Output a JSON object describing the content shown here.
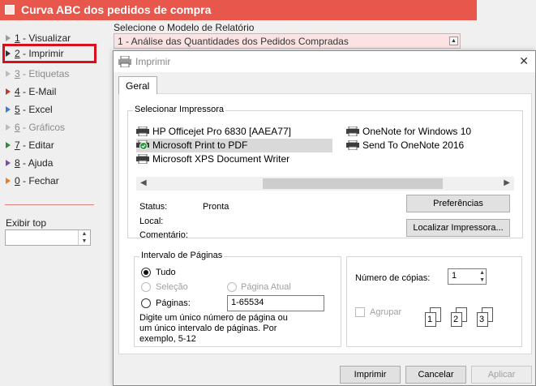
{
  "app": {
    "title": "Curva ABC dos pedidos de compra",
    "menu": [
      {
        "key": "1",
        "label": " - Visualizar",
        "color": "#9a9a9a",
        "disabled": false
      },
      {
        "key": "2",
        "label": " - Imprimir",
        "color": "#333333",
        "disabled": false,
        "selected": true
      },
      {
        "key": "3",
        "label": " - Etiquetas",
        "color": "#9a9a9a",
        "disabled": true
      },
      {
        "key": "4",
        "label": " - E-Mail",
        "color": "#c0392b",
        "disabled": false
      },
      {
        "key": "5",
        "label": " - Excel",
        "color": "#3a7bd5",
        "disabled": false
      },
      {
        "key": "6",
        "label": " - Gráficos",
        "color": "#9a9a9a",
        "disabled": true
      },
      {
        "key": "7",
        "label": " - Editar",
        "color": "#2e8b3a",
        "disabled": false
      },
      {
        "key": "8",
        "label": " - Ajuda",
        "color": "#7a4ea0",
        "disabled": false
      },
      {
        "key": "0",
        "label": " - Fechar",
        "color": "#e67e22",
        "disabled": false
      }
    ],
    "top_label": "Exibir top",
    "top_value": "",
    "model_label": "Selecione o Modelo de Relatório",
    "model_value": "1 - Análise das Quantidades dos Pedidos Compradas"
  },
  "dialog": {
    "title": "Imprimir",
    "tab": "Geral",
    "printer_group": "Selecionar Impressora",
    "printers_left": [
      "HP Officejet Pro 6830 [AAEA77]",
      "Microsoft Print to PDF",
      "Microsoft XPS Document Writer"
    ],
    "printers_right": [
      "OneNote for Windows 10",
      "Send To OneNote 2016"
    ],
    "selected_printer": "Microsoft Print to PDF",
    "status_label": "Status:",
    "status_value": "Pronta",
    "local_label": "Local:",
    "local_value": "",
    "comment_label": "Comentário:",
    "comment_value": "",
    "prefs_button": "Preferências",
    "find_button": "Localizar Impressora...",
    "range_group": "Intervalo de Páginas",
    "range_all": "Tudo",
    "range_selection": "Seleção",
    "range_current": "Página Atual",
    "range_pages": "Páginas:",
    "pages_value": "1-65534",
    "hint": "Digite um único número de página ou um único intervalo de páginas. Por exemplo, 5-12",
    "copies_label": "Número de cópias:",
    "copies_value": "1",
    "collate_label": "Agrupar",
    "print_button": "Imprimir",
    "cancel_button": "Cancelar",
    "apply_button": "Aplicar"
  },
  "colors": {
    "accent": "#e8574b",
    "selected_outline": "#d6111b"
  }
}
